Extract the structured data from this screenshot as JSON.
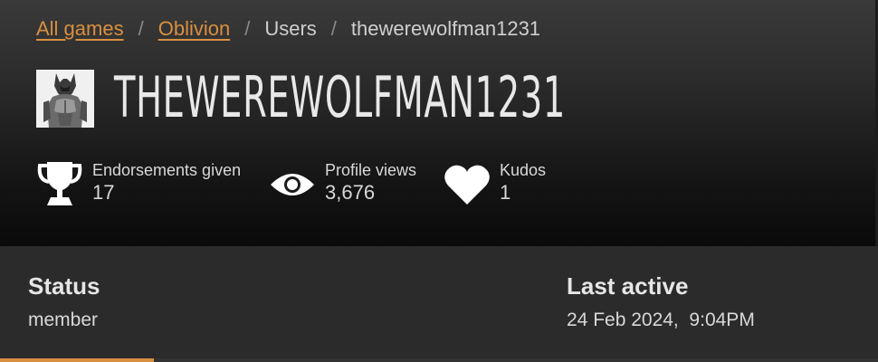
{
  "breadcrumb": {
    "items": [
      {
        "label": "All games",
        "link": true
      },
      {
        "label": "Oblivion",
        "link": true
      },
      {
        "label": "Users",
        "link": false
      },
      {
        "label": "thewerewolfman1231",
        "link": false
      }
    ],
    "separator": "/"
  },
  "profile": {
    "username": "THEWEREWOLFMAN1231",
    "avatar_icon": "werewolf-avatar"
  },
  "stats": [
    {
      "label": "Endorsements given",
      "value": "17",
      "icon": "trophy-icon"
    },
    {
      "label": "Profile views",
      "value": "3,676",
      "icon": "eye-icon"
    },
    {
      "label": "Kudos",
      "value": "1",
      "icon": "heart-icon"
    }
  ],
  "details": {
    "status": {
      "label": "Status",
      "value": "member"
    },
    "last_active": {
      "label": "Last active",
      "value": "24 Feb 2024,  9:04PM"
    }
  },
  "colors": {
    "accent": "#d98f40",
    "header_dark": "#0a0a0a",
    "body_bg": "#2b2b2b"
  }
}
